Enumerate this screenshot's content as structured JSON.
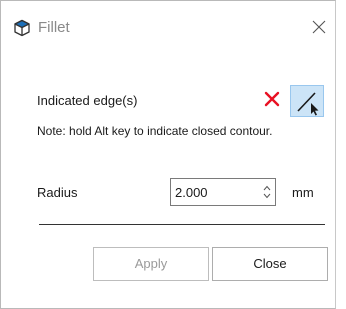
{
  "window": {
    "title": "Fillet",
    "icon": "fillet-cube-icon",
    "close_icon": "close-icon"
  },
  "edge_selection": {
    "label": "Indicated edge(s)",
    "clear_icon": "red-x-icon",
    "select_icon": "edge-select-cursor-icon",
    "note": "Note: hold Alt key to indicate closed contour."
  },
  "radius": {
    "label": "Radius",
    "value": "2.000",
    "unit": "mm"
  },
  "buttons": {
    "apply_label": "Apply",
    "apply_enabled": false,
    "close_label": "Close"
  },
  "colors": {
    "title_text": "#8a8a8a",
    "clear_red": "#e81123",
    "selected_tool_bg": "#cce4f7",
    "cube_icon_blue": "#1c6fb8"
  }
}
